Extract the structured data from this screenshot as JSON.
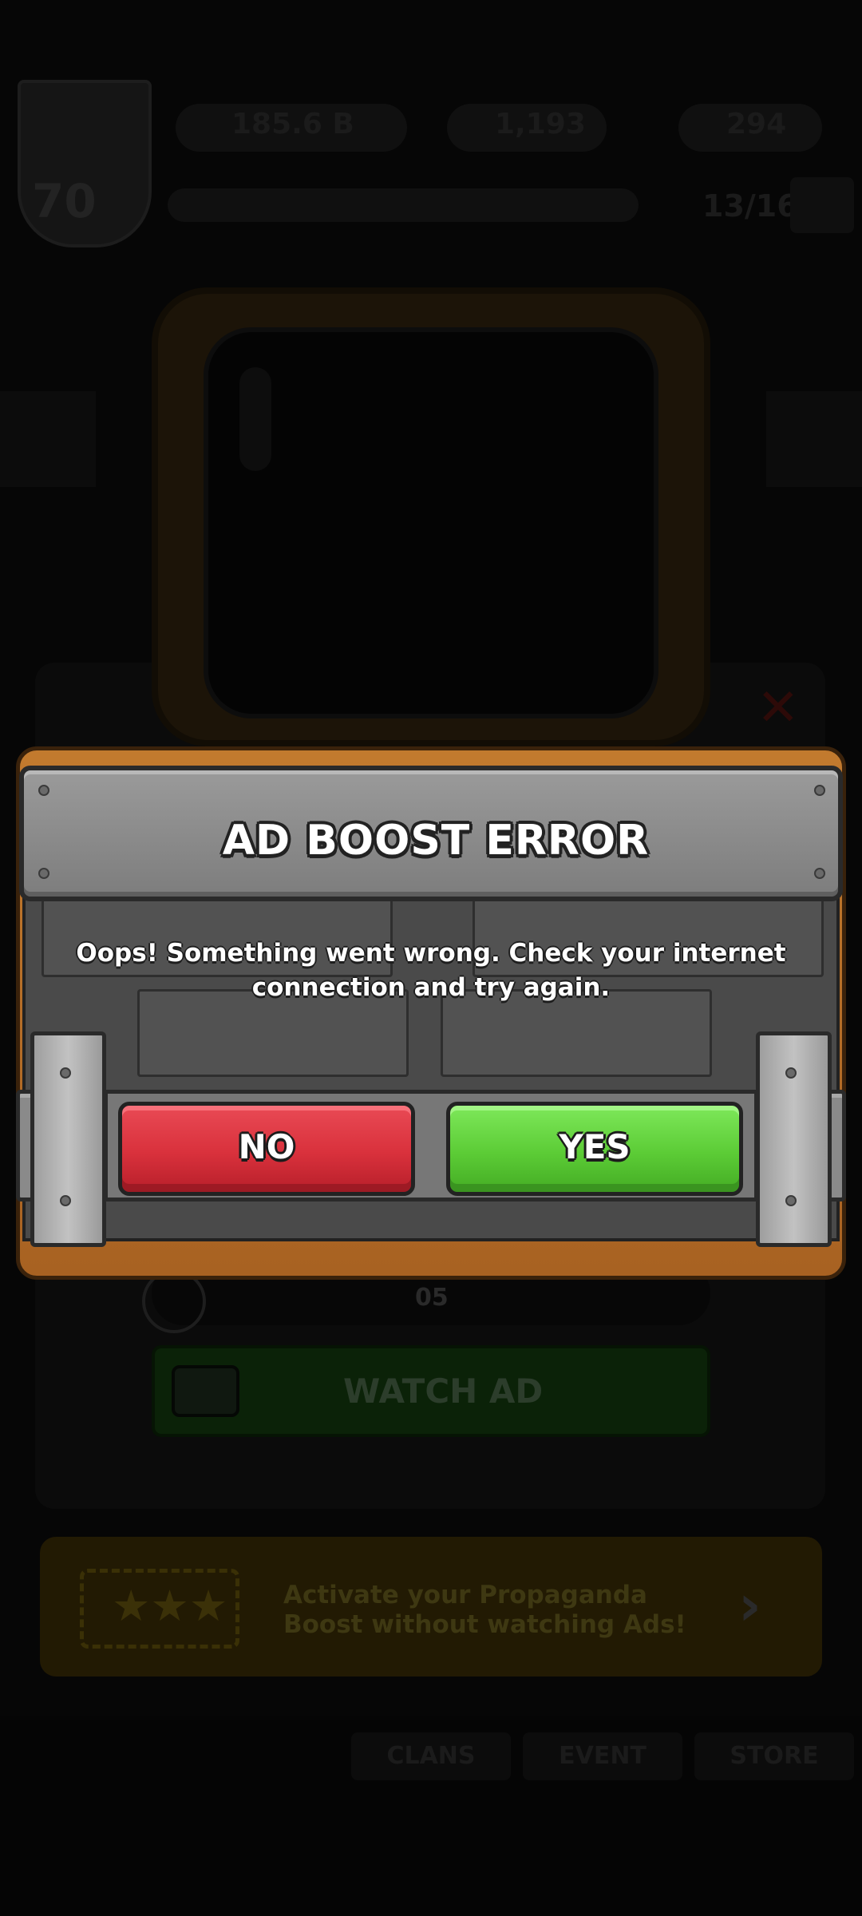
{
  "background": {
    "level": "70",
    "resources": [
      "185.6 B",
      "1,193",
      "294"
    ],
    "xp_progress": "13/16",
    "timer": "05",
    "watch_ad_label": "WATCH AD",
    "promo_text": "Activate your Propaganda Boost without watching Ads!",
    "tabs": [
      "CLANS",
      "EVENT",
      "STORE"
    ]
  },
  "modal": {
    "title": "AD BOOST ERROR",
    "message": "Oops! Something went wrong. Check your internet connection and try again.",
    "no_label": "NO",
    "yes_label": "YES"
  },
  "colors": {
    "no_button": "#d9313c",
    "yes_button": "#5ccc36",
    "wood_frame": "#b06a26",
    "metal": "#4a4a4a"
  }
}
